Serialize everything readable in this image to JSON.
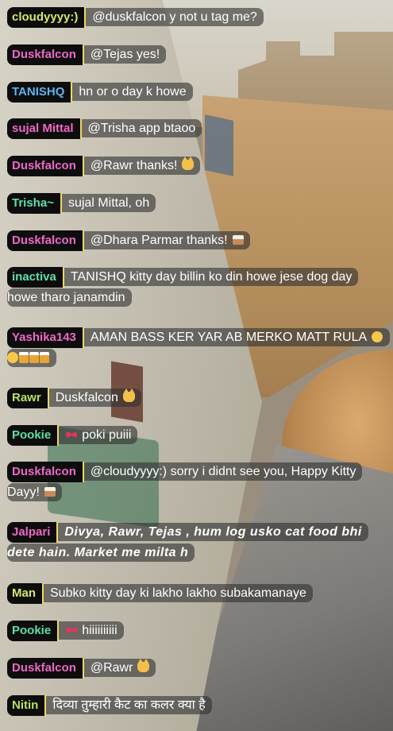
{
  "chat": {
    "messages": [
      {
        "user": "cloudyyyy:)",
        "user_color": "#d8e86a",
        "text": "@duskfalcon y not u tag me?",
        "emoji": []
      },
      {
        "user": "Duskfalcon",
        "user_color": "#ee68c8",
        "text": "@Tejas yes!",
        "emoji": []
      },
      {
        "user": "TANISHQ",
        "user_color": "#5fb4f0",
        "text": "hn or o day k howe",
        "emoji": []
      },
      {
        "user": "sujal Mittal",
        "user_color": "#ee68c8",
        "text": "@Trisha app btaoo",
        "emoji": []
      },
      {
        "user": "Duskfalcon",
        "user_color": "#ee68c8",
        "text": "@Rawr thanks!",
        "emoji": [
          "cat-emoji"
        ]
      },
      {
        "user": "Trisha~",
        "user_color": "#5fe0a8",
        "text": "sujal Mittal, oh",
        "emoji": []
      },
      {
        "user": "Duskfalcon",
        "user_color": "#ee68c8",
        "text": "@Dhara Parmar thanks!",
        "emoji": [
          "cake-emoji"
        ]
      },
      {
        "user": "inactiva",
        "user_color": "#5fe0a8",
        "text": "TANISHQ kitty day billin ko din howe jese dog day howe tharo janamdin",
        "emoji": []
      },
      {
        "user": "Yashika143",
        "user_color": "#ee68c8",
        "text": "AMAN BASS KER YAR AB MERKO MATT RULA",
        "emoji": [
          "crying-emoji",
          "crying-emoji",
          "beer-emoji",
          "beer-emoji",
          "beer-emoji"
        ]
      },
      {
        "user": "Rawr",
        "user_color": "#b8e060",
        "text": "Duskfalcon",
        "emoji": [
          "cat-emoji"
        ]
      },
      {
        "user": "Pookie",
        "user_color": "#5fe0a8",
        "text": "poki puiii",
        "emoji": [],
        "name_badge": "bow-emoji"
      },
      {
        "user": "Duskfalcon",
        "user_color": "#ee68c8",
        "text": "@cloudyyyy:) sorry i didnt see you, Happy Kitty Dayy!",
        "emoji": [
          "cake-emoji"
        ]
      },
      {
        "user": "Jalpari",
        "user_color": "#ee68c8",
        "text": "Divya, Rawr, Tejas , hum log usko cat food bhi dete hain. Market me milta h",
        "emoji": [],
        "fancy": true
      },
      {
        "user": "Man",
        "user_color": "#d8e86a",
        "text": "Subko kitty day ki lakho lakho subakamanaye",
        "emoji": []
      },
      {
        "user": "Pookie",
        "user_color": "#5fe0a8",
        "text": "hiiiiiiiiii",
        "emoji": [],
        "name_badge": "bow-emoji"
      },
      {
        "user": "Duskfalcon",
        "user_color": "#ee68c8",
        "text": "@Rawr",
        "emoji": [
          "cat-emoji"
        ]
      },
      {
        "user": "Nitin",
        "user_color": "#b8e060",
        "text": "दिव्या तुम्हारी कैट का कलर क्या है",
        "emoji": []
      }
    ]
  }
}
